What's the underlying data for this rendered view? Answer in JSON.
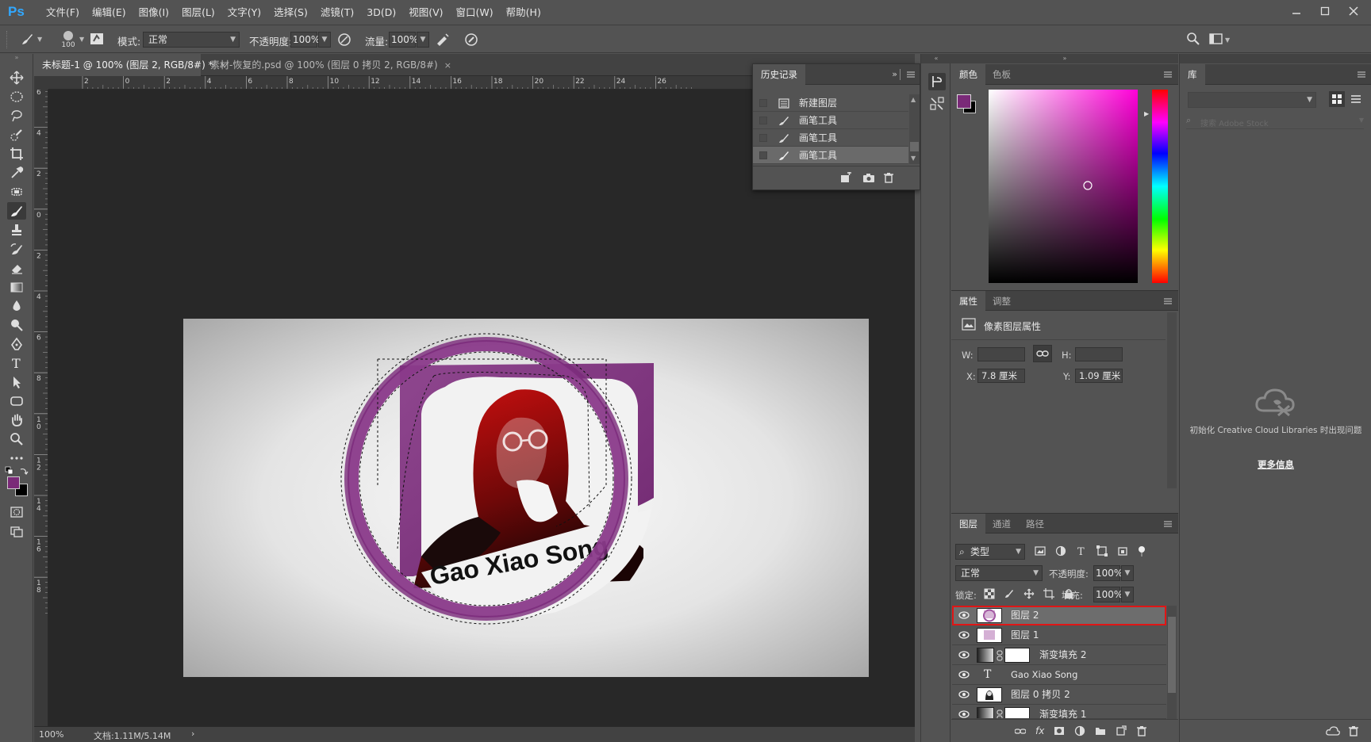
{
  "app": {
    "logo": "Ps"
  },
  "menubar": {
    "items": [
      "文件(F)",
      "编辑(E)",
      "图像(I)",
      "图层(L)",
      "文字(Y)",
      "选择(S)",
      "滤镜(T)",
      "3D(D)",
      "视图(V)",
      "窗口(W)",
      "帮助(H)"
    ]
  },
  "options": {
    "brush_size": "100",
    "mode_label": "模式:",
    "mode_value": "正常",
    "opacity_label": "不透明度:",
    "opacity_value": "100%",
    "flow_label": "流量:",
    "flow_value": "100%"
  },
  "tabs": [
    {
      "label": "未标题-1 @ 100% (图层 2, RGB/8#) *",
      "close": "×"
    },
    {
      "label": "素材-恢复的.psd @ 100% (图层 0 拷贝 2, RGB/8#)",
      "close": "×"
    }
  ],
  "rulers": {
    "top": [
      "2",
      "0",
      "2",
      "4",
      "6",
      "8",
      "10",
      "12",
      "14",
      "16",
      "18",
      "20",
      "22",
      "24",
      "26"
    ],
    "left": [
      "6",
      "4",
      "2",
      "0",
      "2",
      "4",
      "6",
      "8",
      "1\n0",
      "1\n2",
      "1\n4",
      "1\n6",
      "1\n8"
    ]
  },
  "canvas": {
    "artwork_text": "Gao Xiao Song"
  },
  "status": {
    "zoom": "100%",
    "doc": "文档:1.11M/5.14M",
    "arrow": "›"
  },
  "history": {
    "title": "历史记录",
    "items": [
      {
        "label": "新建图层",
        "icon": "new-layer-icon"
      },
      {
        "label": "画笔工具",
        "icon": "brush-icon"
      },
      {
        "label": "画笔工具",
        "icon": "brush-icon"
      },
      {
        "label": "画笔工具",
        "icon": "brush-icon"
      }
    ]
  },
  "color_panel": {
    "tab_active": "颜色",
    "tab_inactive": "色板",
    "fg_color": "#7a2a78",
    "bg_color": "#000000"
  },
  "properties": {
    "tab_active": "属性",
    "tab_inactive": "调整",
    "heading": "像素图层属性",
    "w_label": "W:",
    "h_label": "H:",
    "x_label": "X:",
    "x_value": "7.8 厘米",
    "y_label": "Y:",
    "y_value": "1.09 厘米"
  },
  "layers_panel": {
    "tabs": [
      "图层",
      "通道",
      "路径"
    ],
    "filter_value": "类型",
    "blend_value": "正常",
    "opacity_label": "不透明度:",
    "opacity_value": "100%",
    "lock_label": "锁定:",
    "fill_label": "填充:",
    "fill_value": "100%",
    "layers": [
      {
        "name": "图层 2",
        "selected": true
      },
      {
        "name": "图层 1"
      },
      {
        "name": "渐变填充 2"
      },
      {
        "name": "Gao Xiao Song",
        "type": "T"
      },
      {
        "name": "图层 0 拷贝 2"
      },
      {
        "name": "渐变填充 1"
      }
    ]
  },
  "library": {
    "title": "库",
    "search_placeholder": "搜索 Adobe Stock",
    "message": "初始化 Creative Cloud Libraries 时出现问题",
    "more_link": "更多信息"
  }
}
